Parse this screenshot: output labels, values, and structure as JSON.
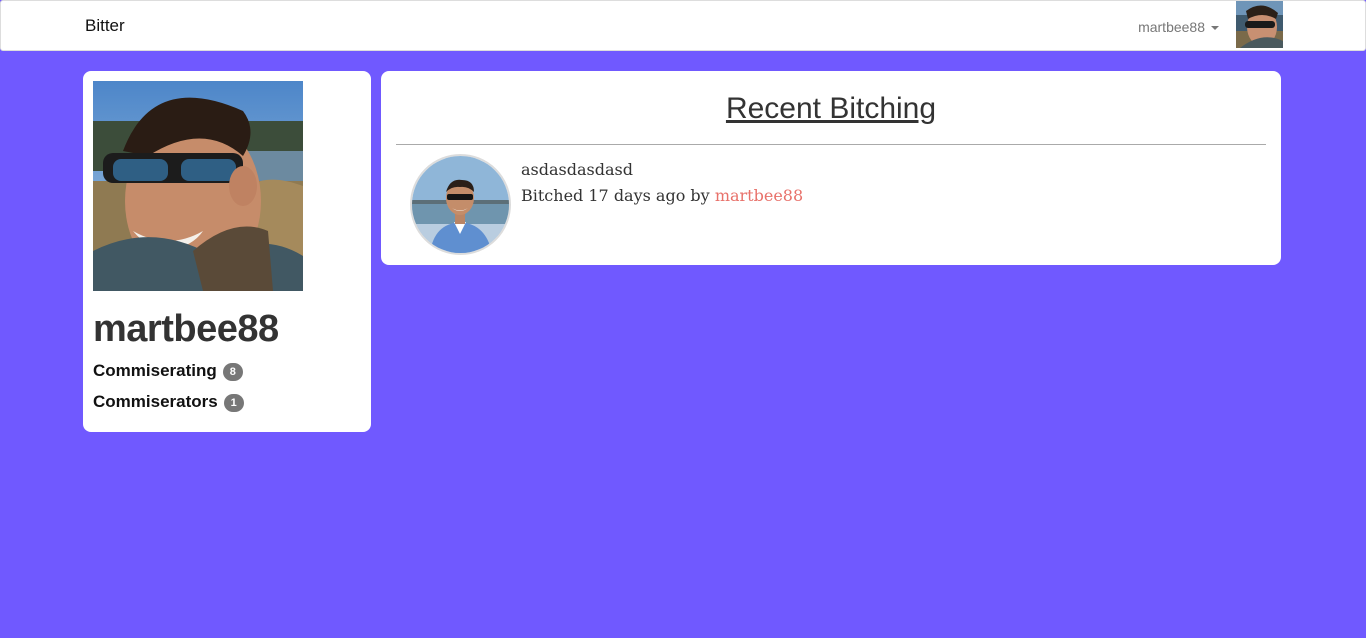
{
  "navbar": {
    "brand": "Bitter",
    "username": "martbee88"
  },
  "profile": {
    "username": "martbee88",
    "stats": [
      {
        "label": "Commiserating",
        "count": "8"
      },
      {
        "label": "Commiserators",
        "count": "1"
      }
    ]
  },
  "feed": {
    "title": "Recent Bitching",
    "posts": [
      {
        "text": "asdasdasdasd",
        "meta_prefix": "Bitched 17 days ago by",
        "author": "martbee88"
      }
    ]
  },
  "colors": {
    "background": "#7059ff",
    "link": "#e8716a",
    "badge": "#777777"
  }
}
